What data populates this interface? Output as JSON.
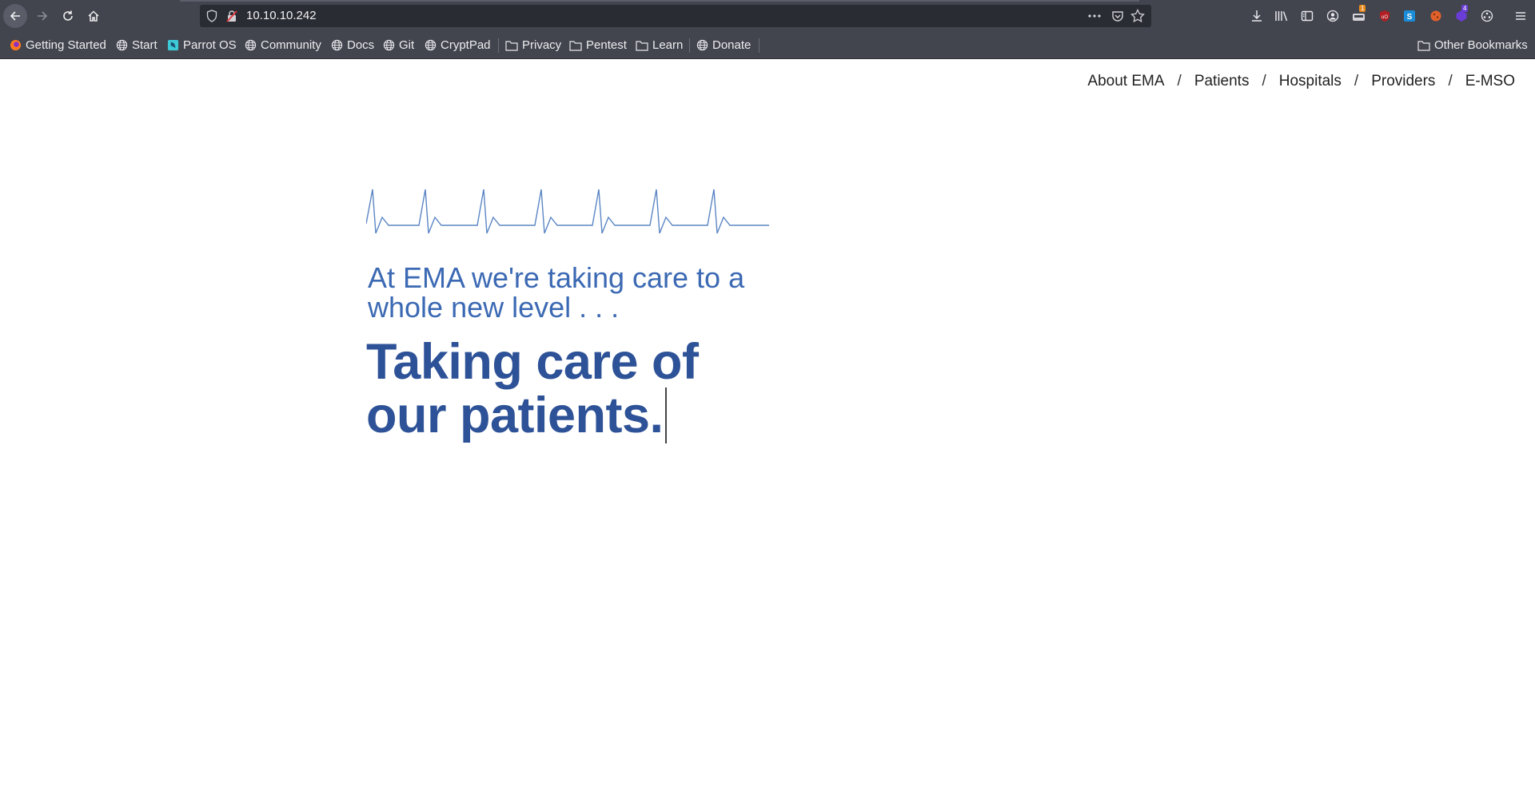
{
  "browser": {
    "url": "10.10.10.242",
    "badges": {
      "ext1": "1",
      "ext2": "4"
    }
  },
  "bookmarks": {
    "items": [
      {
        "label": "Getting Started"
      },
      {
        "label": "Start"
      },
      {
        "label": "Parrot OS"
      },
      {
        "label": "Community"
      },
      {
        "label": "Docs"
      },
      {
        "label": "Git"
      },
      {
        "label": "CryptPad"
      },
      {
        "label": "Privacy"
      },
      {
        "label": "Pentest"
      },
      {
        "label": "Learn"
      },
      {
        "label": "Donate"
      }
    ],
    "other": "Other Bookmarks"
  },
  "site": {
    "nav": [
      "About EMA",
      "Patients",
      "Hospitals",
      "Providers",
      "E-MSO"
    ],
    "separator": "/",
    "tagline_line1": "At EMA we're taking care to a",
    "tagline_line2": "whole new level . . .",
    "headline_line1": "Taking care of",
    "headline_line2": "our patients."
  },
  "colors": {
    "chrome": "#42444e",
    "urlbar": "#2a2c33",
    "accent_light": "#3b69b3",
    "accent_dark": "#2e5297"
  }
}
